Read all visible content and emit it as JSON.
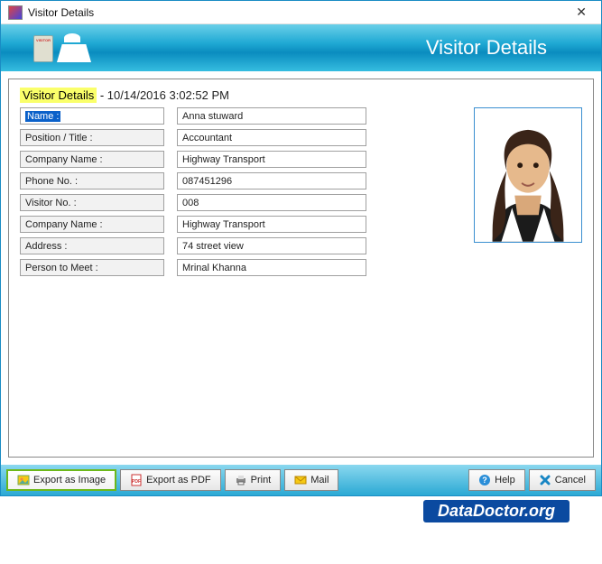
{
  "window": {
    "title": "Visitor Details"
  },
  "banner": {
    "title": "Visitor Details"
  },
  "heading": {
    "label": "Visitor Details",
    "sep": " - ",
    "timestamp": "10/14/2016 3:02:52 PM"
  },
  "fields": [
    {
      "label": "Name :",
      "value": "Anna stuward"
    },
    {
      "label": "Position / Title :",
      "value": "Accountant"
    },
    {
      "label": "Company Name :",
      "value": "Highway Transport"
    },
    {
      "label": "Phone No. :",
      "value": "087451296"
    },
    {
      "label": "Visitor No. :",
      "value": "008"
    },
    {
      "label": "Company Name :",
      "value": "Highway Transport"
    },
    {
      "label": "Address :",
      "value": "74 street view"
    },
    {
      "label": "Person to Meet :",
      "value": "Mrinal Khanna"
    }
  ],
  "buttons": {
    "export_image": "Export as Image",
    "export_pdf": "Export as PDF",
    "print": "Print",
    "mail": "Mail",
    "help": "Help",
    "cancel": "Cancel"
  },
  "brand": "DataDoctor.org"
}
